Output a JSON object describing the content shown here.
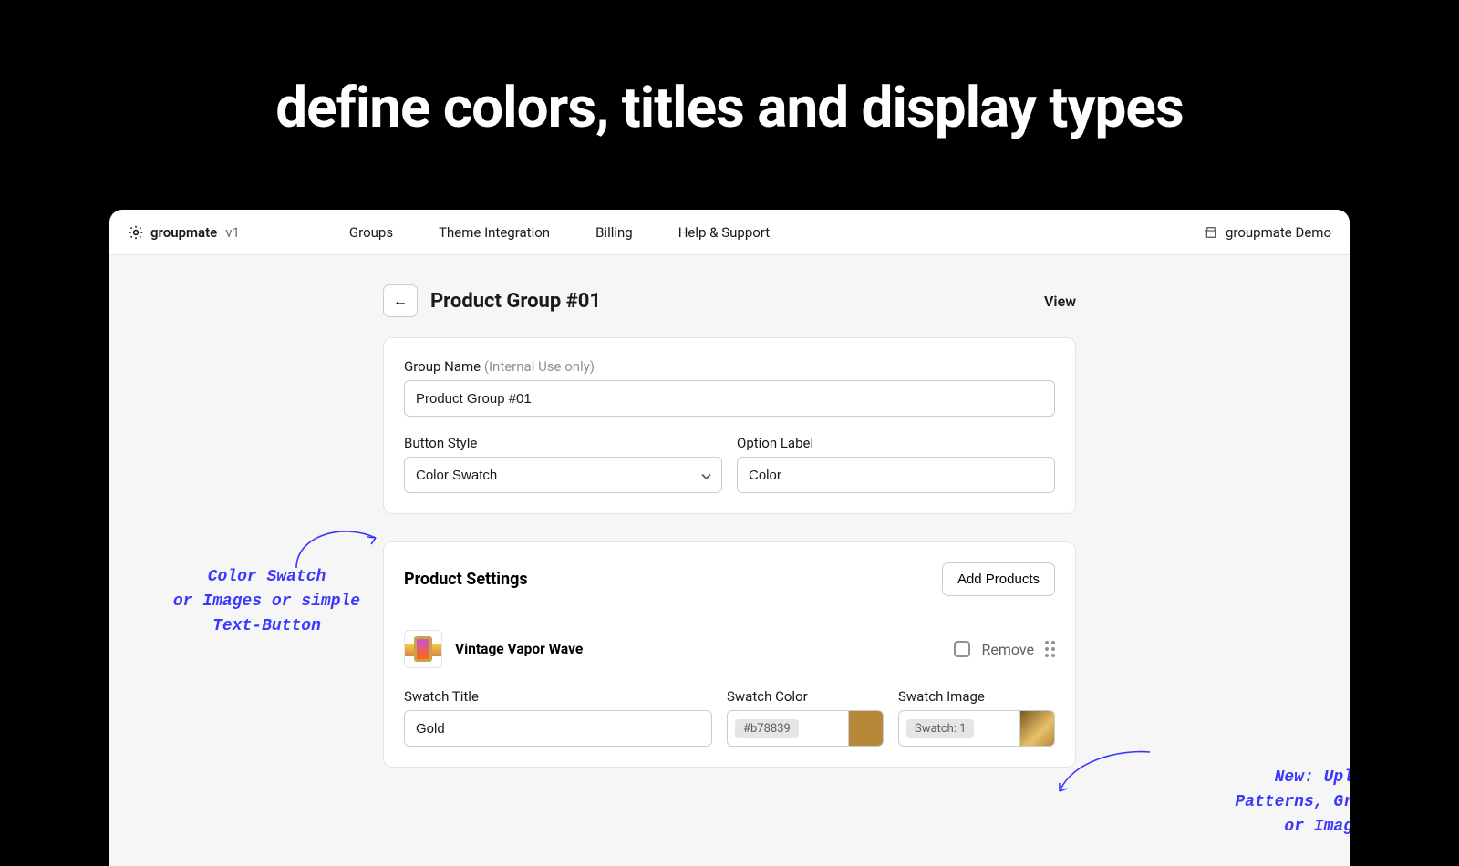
{
  "hero": {
    "title": "define colors, titles and display types"
  },
  "topbar": {
    "brand": "groupmate",
    "version": "v1",
    "tabs": [
      "Groups",
      "Theme Integration",
      "Billing",
      "Help & Support"
    ],
    "right_label": "groupmate Demo"
  },
  "page": {
    "title": "Product Group #01",
    "view_label": "View"
  },
  "group_card": {
    "name_label": "Group Name",
    "name_hint": "(Internal Use only)",
    "name_value": "Product Group #01",
    "button_style_label": "Button Style",
    "button_style_value": "Color Swatch",
    "option_label_label": "Option Label",
    "option_label_value": "Color"
  },
  "settings_card": {
    "title": "Product Settings",
    "add_button": "Add Products",
    "product_name": "Vintage Vapor Wave",
    "remove_label": "Remove",
    "swatch_title_label": "Swatch Title",
    "swatch_title_value": "Gold",
    "swatch_color_label": "Swatch Color",
    "swatch_color_value": "#b78839",
    "swatch_image_label": "Swatch Image",
    "swatch_image_value": "Swatch: 1"
  },
  "annotations": {
    "left": "Color Swatch\nor Images or simple\nText-Button",
    "right": "New: Upload\nPatterns, Gradients\nor Images"
  }
}
